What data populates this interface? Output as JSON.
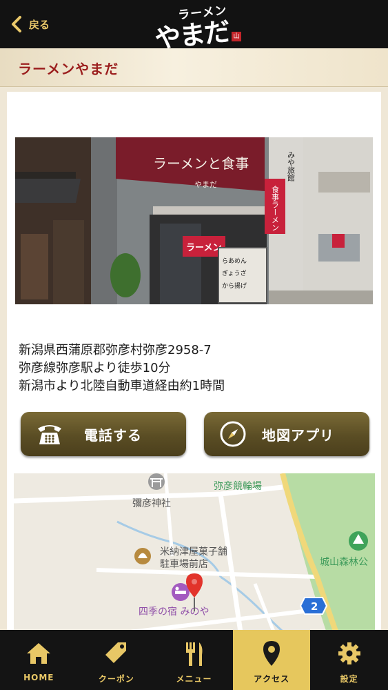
{
  "header": {
    "back_label": "戻る",
    "logo_small": "ラーメン",
    "logo_big": "やまだ",
    "logo_stamp": "山"
  },
  "page": {
    "title": "ラーメンやまだ"
  },
  "photo": {
    "awning_text": "ラーメンと食事",
    "awning_sub": "やまだ",
    "sign_vertical": "食事ラーメン",
    "inn_sign": "みや旅館",
    "flag_text": "ラーメン",
    "menu_board": [
      "らあめん",
      "ぎょうざ",
      "から揚げ"
    ]
  },
  "address": {
    "lines": [
      "新潟県西蒲原郡弥彦村弥彦2958-7",
      "弥彦線弥彦駅より徒歩10分",
      "新潟市より北陸自動車道経由約1時間"
    ]
  },
  "buttons": {
    "phone_label": "電話する",
    "map_label": "地図アプリ"
  },
  "map": {
    "labels": {
      "shrine": "彌彦神社",
      "velodrome": "弥彦競輪場",
      "parking_line1": "米納津屋菓子舗",
      "parking_line2": "駐車場前店",
      "forest": "城山森林公",
      "inn": "四季の宿 みのや",
      "route_badge": "2"
    }
  },
  "tabs": [
    {
      "label": "HOME",
      "icon": "home-icon",
      "active": false
    },
    {
      "label": "クーポン",
      "icon": "coupon-tag-icon",
      "active": false
    },
    {
      "label": "メニュー",
      "icon": "cutlery-icon",
      "active": false
    },
    {
      "label": "アクセス",
      "icon": "map-pin-icon",
      "active": true
    },
    {
      "label": "設定",
      "icon": "gear-icon",
      "active": false
    }
  ],
  "colors": {
    "header_bg": "#121212",
    "accent_gold": "#e8c766",
    "title_red": "#9b1e1e",
    "button_brown": "#5a4d24",
    "map_green": "#b7dca4"
  }
}
